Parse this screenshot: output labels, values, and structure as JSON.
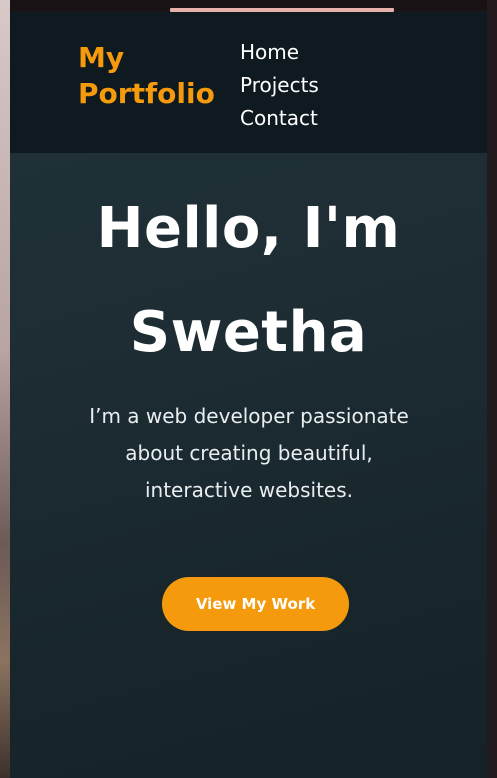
{
  "logo": {
    "text": "My Portfolio",
    "color": "#f59a0c"
  },
  "nav": {
    "links": [
      "Home",
      "Projects",
      "Contact"
    ]
  },
  "hero": {
    "title": "Hello, I'm Swetha",
    "subtitle": "I’m a web developer passionate about creating beautiful, interactive websites.",
    "cta_label": "View My Work"
  },
  "colors": {
    "accent": "#f59a0c",
    "navbar_bg": "#0e1a1f",
    "hero_bg": "#1d2d33",
    "text": "#ffffff"
  }
}
